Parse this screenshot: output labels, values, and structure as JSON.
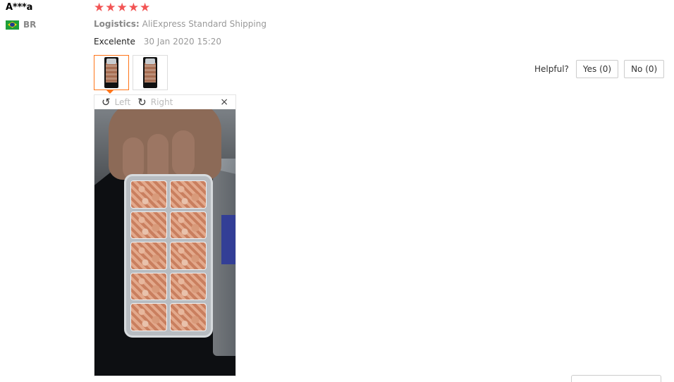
{
  "review": {
    "user_name": "A***a",
    "country_code": "BR",
    "rating": 5,
    "logistics_label": "Logistics:",
    "logistics_value": "AliExpress Standard Shipping",
    "feedback_text": "Excelente",
    "feedback_date": "30 Jan 2020 15:20",
    "star_color": "#f25454"
  },
  "photos": {
    "thumbnails": [
      "thumbnail-1",
      "thumbnail-2"
    ],
    "selected_index": 0,
    "viewer": {
      "rotate_left_label": "Left",
      "rotate_right_label": "Right",
      "close_symbol": "×"
    }
  },
  "helpful": {
    "label": "Helpful?",
    "yes_label": "Yes (0)",
    "no_label": "No (0)"
  },
  "icons": {
    "flag": "brazil-flag-icon",
    "star": "star-icon",
    "rotate_left": "rotate-left-icon",
    "rotate_right": "rotate-right-icon",
    "close": "close-icon"
  },
  "colors": {
    "accent": "#ff7519",
    "star": "#f25454"
  }
}
